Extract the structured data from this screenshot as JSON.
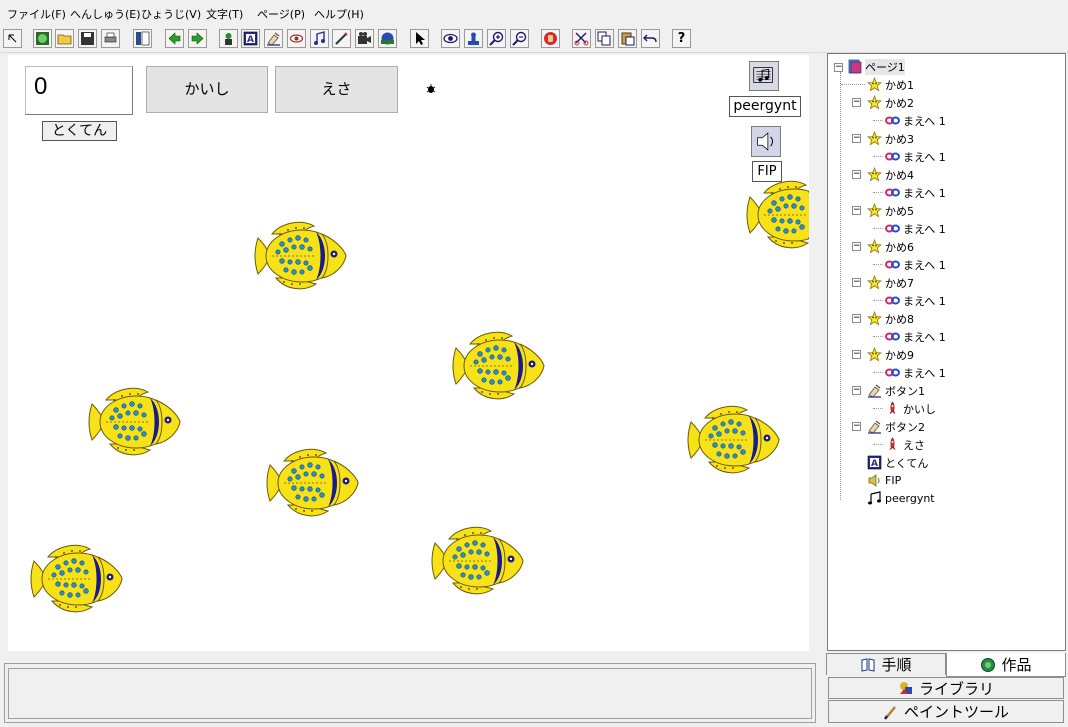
{
  "menu": [
    "ファイル(F)",
    "へんしゅう(E)",
    "ひょうじ(V)",
    "文字(T)",
    "ページ(P)",
    "ヘルプ(H)"
  ],
  "toolbar": {
    "buttons": [
      "restore-icon",
      "new-page-icon",
      "open-folder-icon",
      "save-icon",
      "print-icon",
      "layout-icon",
      "back-arrow-icon",
      "forward-arrow-icon",
      "character-icon",
      "text-box-icon",
      "paint-icon",
      "eye-sound-icon",
      "music-note-icon",
      "pen-icon",
      "movie-icon",
      "globe-icon",
      "pointer-icon",
      "view-icon",
      "stamp-icon",
      "zoom-in-icon",
      "zoom-out-icon",
      "stop-hand-icon",
      "cut-icon",
      "copy-icon",
      "paste-icon",
      "undo-icon",
      "help-icon"
    ],
    "help_label": "?"
  },
  "stage": {
    "score_value": "0",
    "score_label": "とくてん",
    "start_button": "かいし",
    "feed_button": "えさ",
    "music_label": "peergynt",
    "sound_label": "FIP"
  },
  "tree": {
    "root": "ページ1",
    "turtles": [
      {
        "name": "かめ1",
        "child": ""
      },
      {
        "name": "かめ2",
        "child": "まえへ 1"
      },
      {
        "name": "かめ3",
        "child": "まえへ 1"
      },
      {
        "name": "かめ4",
        "child": "まえへ 1"
      },
      {
        "name": "かめ5",
        "child": "まえへ 1"
      },
      {
        "name": "かめ6",
        "child": "まえへ 1"
      },
      {
        "name": "かめ7",
        "child": "まえへ 1"
      },
      {
        "name": "かめ8",
        "child": "まえへ 1"
      },
      {
        "name": "かめ9",
        "child": "まえへ 1"
      }
    ],
    "buttons": [
      {
        "name": "ボタン1",
        "child": "かいし"
      },
      {
        "name": "ボタン2",
        "child": "えさ"
      }
    ],
    "text_item": "とくてん",
    "sound_item": "FIP",
    "music_item": "peergynt"
  },
  "tabs": {
    "procedure": "手順",
    "work": "作品",
    "library": "ライブラリ",
    "paint_tool": "ペイントツール"
  },
  "colors": {
    "fish_body": "#f7e21a",
    "fish_stripe": "#1a1a8c",
    "fish_spots": "#2a8fc9",
    "stage_bg": "#ffffff"
  }
}
